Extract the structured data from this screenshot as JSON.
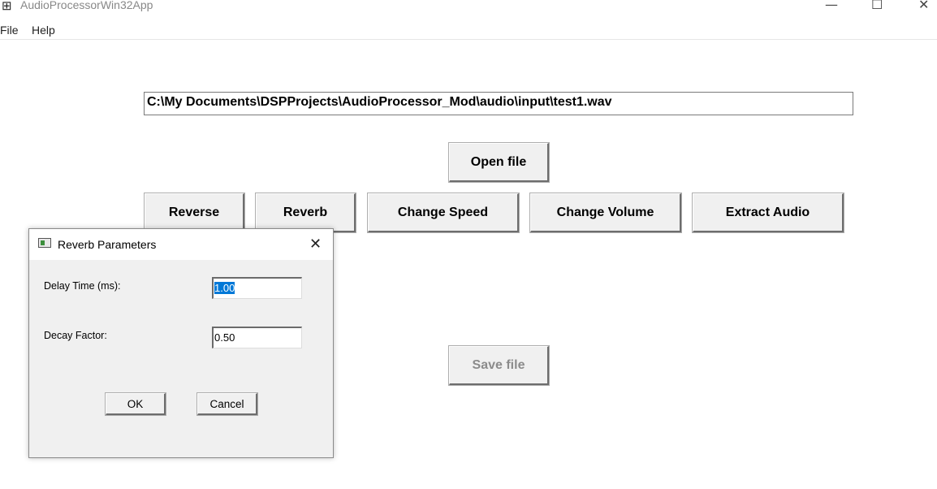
{
  "window": {
    "title": "AudioProcessorWin32App",
    "icon": "app-grid-icon",
    "minimize_glyph": "—",
    "maximize_glyph": "☐",
    "close_glyph": "✕"
  },
  "menu": {
    "items": [
      {
        "label": "File"
      },
      {
        "label": "Help"
      }
    ]
  },
  "main": {
    "file_path": "C:\\My Documents\\DSPProjects\\AudioProcessor_Mod\\audio\\input\\test1.wav",
    "open_file_label": "Open file",
    "effects": [
      {
        "label": "Reverse"
      },
      {
        "label": "Reverb"
      },
      {
        "label": "Change Speed"
      },
      {
        "label": "Change Volume"
      },
      {
        "label": "Extract Audio"
      }
    ],
    "save_file_label": "Save file",
    "save_file_enabled": false
  },
  "dialog": {
    "title": "Reverb Parameters",
    "close_glyph": "✕",
    "delay_label": "Delay Time (ms):",
    "delay_value": "1.00",
    "delay_selected": true,
    "decay_label": "Decay Factor:",
    "decay_value": "0.50",
    "ok_label": "OK",
    "cancel_label": "Cancel"
  }
}
